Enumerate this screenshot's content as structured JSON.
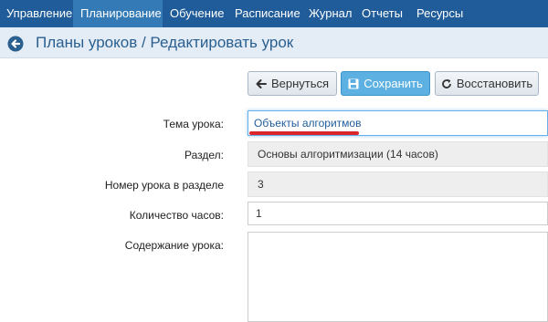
{
  "nav": {
    "items": [
      {
        "label": "Управление"
      },
      {
        "label": "Планирование",
        "active": true
      },
      {
        "label": "Обучение"
      },
      {
        "label": "Расписание"
      },
      {
        "label": "Журнал"
      },
      {
        "label": "Отчеты"
      },
      {
        "label": "Ресурсы"
      }
    ]
  },
  "header": {
    "title": "Планы уроков / Редактировать урок",
    "back_icon": "circle-arrow-left-icon"
  },
  "toolbar": {
    "back_label": "Вернуться",
    "save_label": "Сохранить",
    "restore_label": "Восстановить",
    "back_icon": "arrow-left-icon",
    "save_icon": "floppy-disk-icon",
    "restore_icon": "refresh-icon"
  },
  "form": {
    "topic": {
      "label": "Тема урока:",
      "value": "Объекты алгоритмов"
    },
    "section": {
      "label": "Раздел:",
      "value": "Основы алгоритмизации (14 часов)"
    },
    "lesson_number": {
      "label": "Номер урока в разделе",
      "value": "3"
    },
    "hours": {
      "label": "Количество часов:",
      "value": "1"
    },
    "content": {
      "label": "Содержание урока:",
      "value": ""
    }
  },
  "colors": {
    "nav_bg": "#1f5c99",
    "nav_active": "#337ab7",
    "header_bg": "#e4edf6",
    "title": "#2a5f8f",
    "primary_button": "#5cb0e2",
    "annotation_underline": "#d9262c"
  }
}
